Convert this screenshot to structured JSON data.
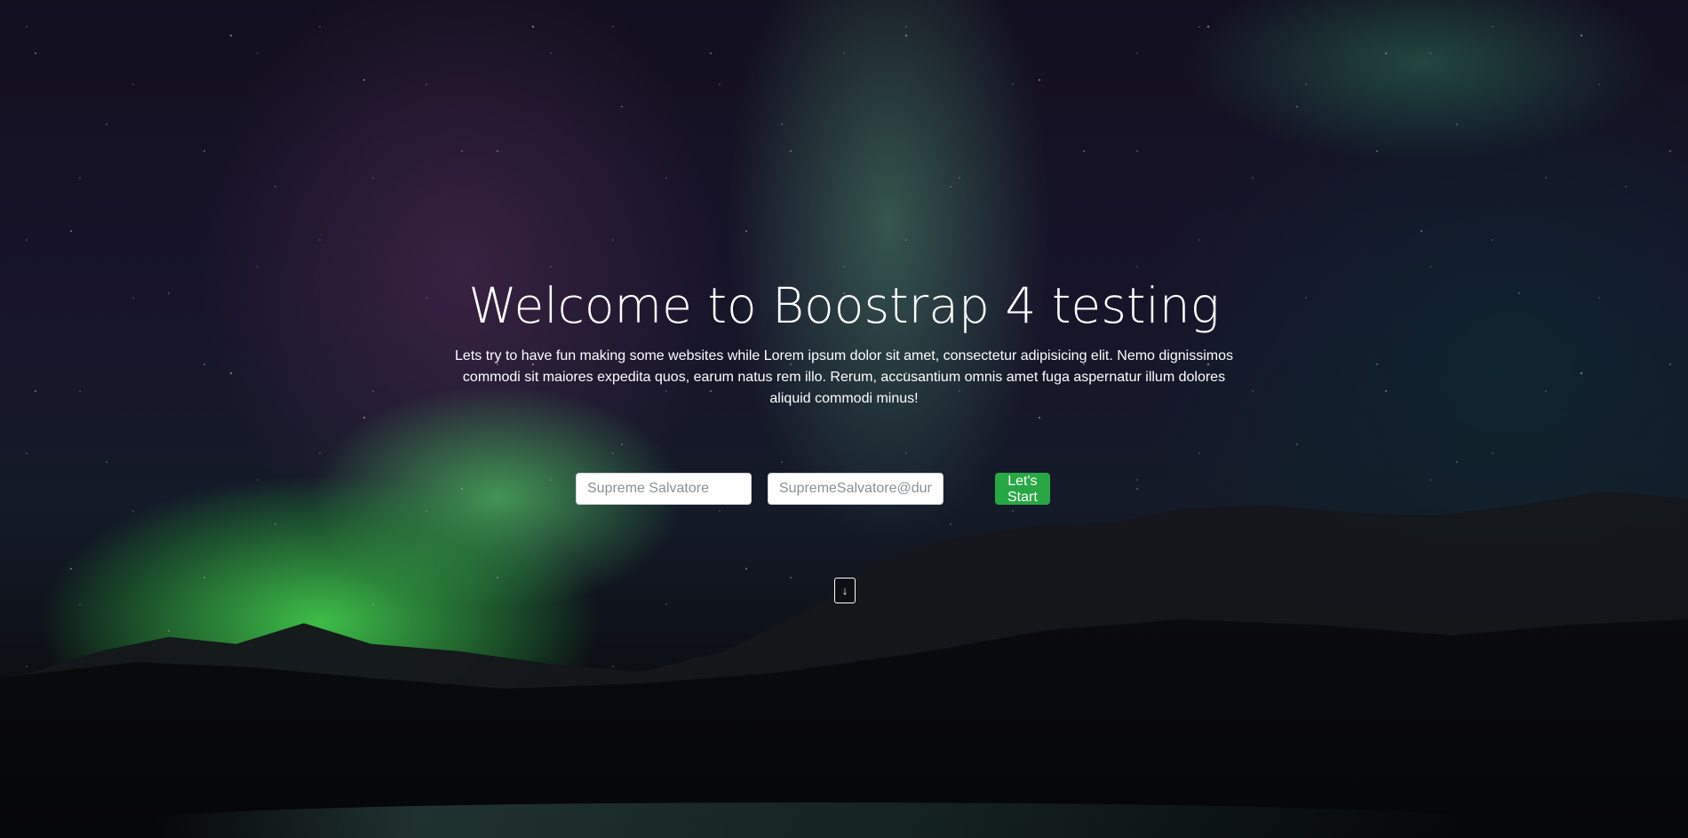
{
  "hero": {
    "title": "Welcome to Boostrap 4 testing",
    "lead": "Lets try to have fun making some websites while Lorem ipsum dolor sit amet, consectetur adipisicing elit. Nemo dignissimos commodi sit maiores expedita quos, earum natus rem illo. Rerum, accusantium omnis amet fuga aspernatur illum dolores aliquid commodi minus!"
  },
  "form": {
    "name_placeholder": "Supreme Salvatore",
    "email_placeholder": "SupremeSalvatore@dummy.com",
    "start_label": "Let's Start"
  },
  "scroll": {
    "icon": "arrow-down-icon",
    "glyph": "↓"
  },
  "colors": {
    "button": "#28a745",
    "text": "#ffffff"
  }
}
